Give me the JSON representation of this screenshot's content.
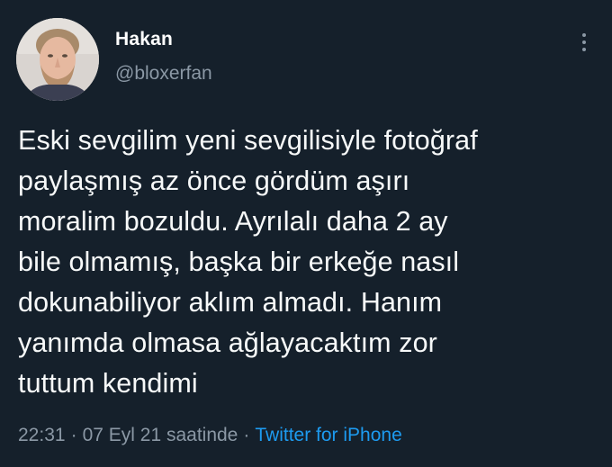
{
  "author": {
    "display_name": "Hakan",
    "handle": "@bloxerfan",
    "avatar_icon": "user-photo-avatar"
  },
  "more_icon": "more-vertical-icon",
  "tweet": {
    "text": "Eski sevgilim yeni sevgilisiyle fotoğraf\npaylaşmış az önce gördüm aşırı\nmoralim bozuldu. Ayrılalı daha 2 ay\nbile olmamış, başka bir erkeğe nasıl\ndokunabiliyor aklım almadı. Hanım\nyanımda olmasa ağlayacaktım zor\ntuttum kendimi"
  },
  "meta": {
    "time": "22:31",
    "separator": "·",
    "date": "07 Eyl 21 saatinde",
    "source": "Twitter for iPhone"
  },
  "colors": {
    "background": "#15202b",
    "text": "#f7f9f9",
    "secondary": "#8b98a5",
    "link": "#1d9bf0"
  }
}
